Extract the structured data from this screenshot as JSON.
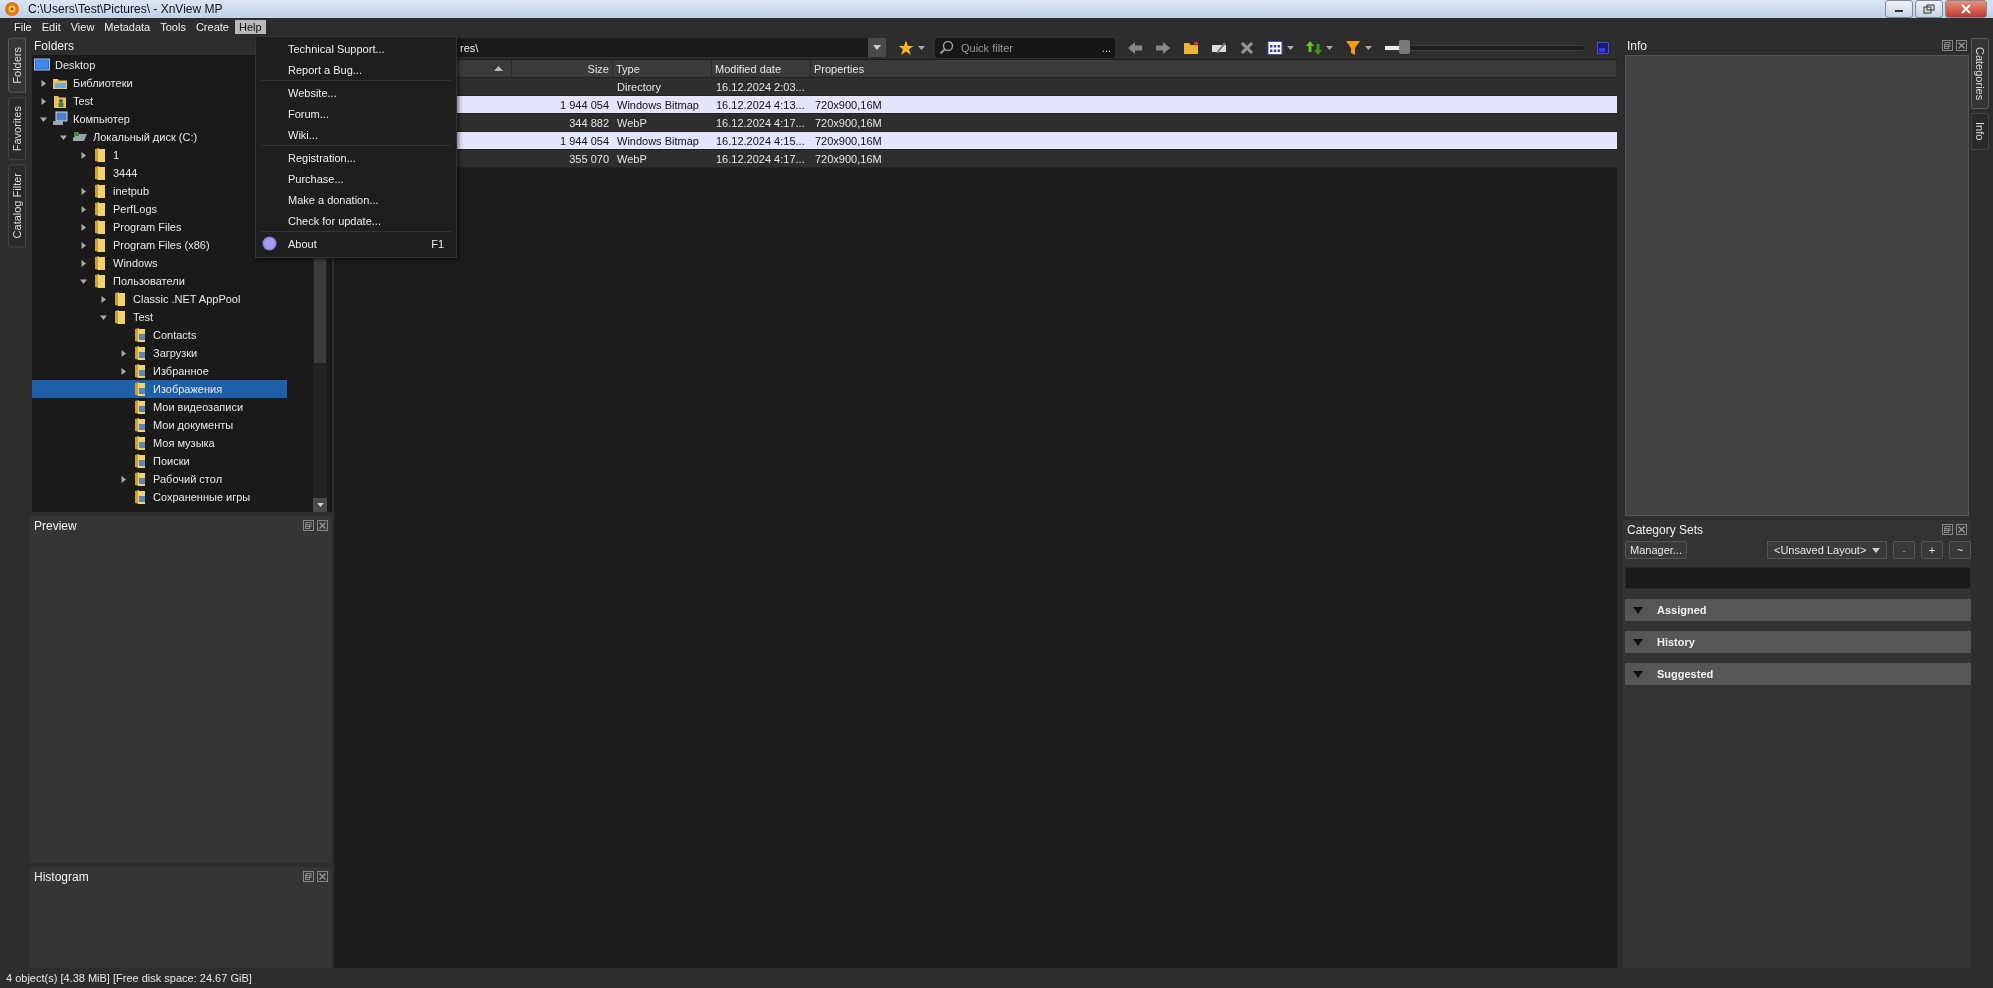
{
  "window": {
    "title": "C:\\Users\\Test\\Pictures\\ - XnView MP"
  },
  "menu_bar": [
    {
      "label": "File",
      "selected": false
    },
    {
      "label": "Edit",
      "selected": false
    },
    {
      "label": "View",
      "selected": false
    },
    {
      "label": "Metadata",
      "selected": false
    },
    {
      "label": "Tools",
      "selected": false
    },
    {
      "label": "Create",
      "selected": false
    },
    {
      "label": "Help",
      "selected": true
    }
  ],
  "help_menu": [
    {
      "kind": "item",
      "label": "Technical Support...",
      "icon": false
    },
    {
      "kind": "item",
      "label": "Report a Bug...",
      "icon": false
    },
    {
      "kind": "separator"
    },
    {
      "kind": "item",
      "label": "Website...",
      "icon": false
    },
    {
      "kind": "item",
      "label": "Forum...",
      "icon": false
    },
    {
      "kind": "item",
      "label": "Wiki...",
      "icon": false
    },
    {
      "kind": "separator"
    },
    {
      "kind": "item",
      "label": "Registration...",
      "icon": false
    },
    {
      "kind": "item",
      "label": "Purchase...",
      "icon": false
    },
    {
      "kind": "item",
      "label": "Make a donation...",
      "icon": false
    },
    {
      "kind": "item",
      "label": "Check for update...",
      "icon": false
    },
    {
      "kind": "separator"
    },
    {
      "kind": "item",
      "label": "About",
      "shortcut": "F1",
      "icon": true
    }
  ],
  "left_tabs": [
    {
      "label": "Folders",
      "selected": true
    },
    {
      "label": "Favorites",
      "selected": false
    },
    {
      "label": "Catalog Filter",
      "selected": false
    }
  ],
  "folders_panel": {
    "title": "Folders",
    "tree": [
      {
        "label": "Desktop",
        "kind": "desktop",
        "selected": false,
        "children": [
          {
            "label": "Библиотеки",
            "kind": "library",
            "expanded": false,
            "selected": false
          },
          {
            "label": "Test",
            "kind": "user",
            "expanded": false,
            "selected": false
          },
          {
            "label": "Компьютер",
            "kind": "computer",
            "expanded": true,
            "selected": false,
            "children": [
              {
                "label": "Локальный диск (C:)",
                "kind": "drive",
                "expanded": true,
                "selected": false,
                "children": [
                  {
                    "label": "1",
                    "kind": "folder",
                    "expanded": false,
                    "selected": false
                  },
                  {
                    "label": "3444",
                    "kind": "folder",
                    "selected": false
                  },
                  {
                    "label": "inetpub",
                    "kind": "folder",
                    "expanded": false,
                    "selected": false
                  },
                  {
                    "label": "PerfLogs",
                    "kind": "folder",
                    "expanded": false,
                    "selected": false
                  },
                  {
                    "label": "Program Files",
                    "kind": "folder",
                    "expanded": false,
                    "selected": false
                  },
                  {
                    "label": "Program Files (x86)",
                    "kind": "folder",
                    "expanded": false,
                    "selected": false
                  },
                  {
                    "label": "Windows",
                    "kind": "folder",
                    "expanded": false,
                    "selected": false
                  },
                  {
                    "label": "Пользователи",
                    "kind": "folder",
                    "expanded": true,
                    "selected": false,
                    "children": [
                      {
                        "label": "Classic .NET AppPool",
                        "kind": "folder",
                        "expanded": false,
                        "selected": false
                      },
                      {
                        "label": "Test",
                        "kind": "folder",
                        "expanded": true,
                        "selected": false,
                        "children": [
                          {
                            "label": "Contacts",
                            "kind": "special",
                            "selected": false
                          },
                          {
                            "label": "Загрузки",
                            "kind": "special",
                            "expanded": false,
                            "selected": false
                          },
                          {
                            "label": "Избранное",
                            "kind": "special",
                            "expanded": false,
                            "selected": false
                          },
                          {
                            "label": "Изображения",
                            "kind": "special",
                            "selected": true
                          },
                          {
                            "label": "Мои видеозаписи",
                            "kind": "special",
                            "selected": false
                          },
                          {
                            "label": "Мои документы",
                            "kind": "special",
                            "selected": false
                          },
                          {
                            "label": "Моя музыка",
                            "kind": "special",
                            "selected": false
                          },
                          {
                            "label": "Поиски",
                            "kind": "special",
                            "selected": false
                          },
                          {
                            "label": "Рабочий стол",
                            "kind": "special",
                            "expanded": false,
                            "selected": false
                          },
                          {
                            "label": "Сохраненные игры",
                            "kind": "special",
                            "selected": false
                          }
                        ]
                      }
                    ]
                  }
                ]
              }
            ]
          }
        ]
      }
    ]
  },
  "preview_panel": {
    "title": "Preview"
  },
  "histogram_panel": {
    "title": "Histogram"
  },
  "path_bar": {
    "value": "res\\"
  },
  "toolbar": {
    "quick_filter": {
      "placeholder": "Quick filter"
    },
    "filter_options": "...",
    "thumbnail_size": {
      "level": 0.08
    }
  },
  "file_list": {
    "name_column": {
      "sort_ascending": true
    },
    "columns": [
      {
        "label": "Size"
      },
      {
        "label": "Type"
      },
      {
        "label": "Modified date"
      },
      {
        "label": "Properties"
      }
    ],
    "rows": [
      {
        "selected": false,
        "cells": [
          null,
          "Directory",
          "16.12.2024 2:03...",
          null
        ]
      },
      {
        "selected": true,
        "cells": [
          "1 944 054",
          "Windows Bitmap",
          "16.12.2024 4:13...",
          "720x900,16M"
        ]
      },
      {
        "selected": false,
        "cells": [
          "344 882",
          "WebP",
          "16.12.2024 4:17...",
          "720x900,16M"
        ]
      },
      {
        "selected": true,
        "cells": [
          "1 944 054",
          "Windows Bitmap",
          "16.12.2024 4:15...",
          "720x900,16M"
        ]
      },
      {
        "selected": false,
        "cells": [
          "355 070",
          "WebP",
          "16.12.2024 4:17...",
          "720x900,16M"
        ]
      }
    ]
  },
  "info_panel": {
    "title": "Info"
  },
  "right_tabs": [
    {
      "label": "Categories",
      "selected": true
    },
    {
      "label": "Info",
      "selected": false
    }
  ],
  "category_sets": {
    "title": "Category Sets",
    "manager_button": "Manager...",
    "layout": "<Unsaved Layout>",
    "buttons": [
      "-",
      "+",
      "~"
    ],
    "sections": [
      {
        "label": "Assigned",
        "expanded": true
      },
      {
        "label": "History",
        "expanded": true
      },
      {
        "label": "Suggested",
        "expanded": true
      }
    ]
  },
  "status_bar": {
    "text": "4 object(s) [4.38 MiB] [Free disk space: 24.67 GiB]"
  }
}
